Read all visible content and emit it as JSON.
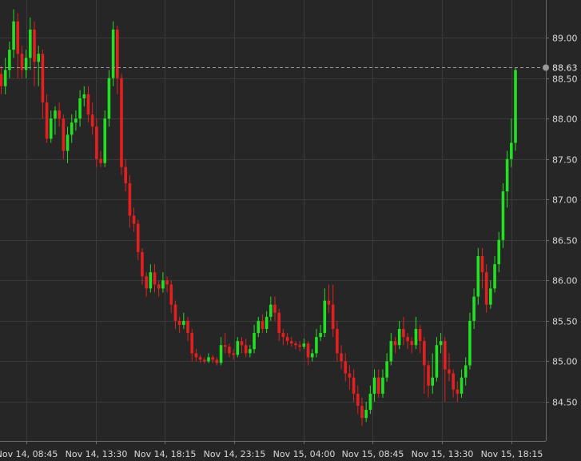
{
  "chart_data": {
    "type": "candlestick",
    "title": "",
    "ylim": [
      84.1,
      89.35
    ],
    "y_ticks": [
      "89.00",
      "88.50",
      "88.00",
      "87.50",
      "87.00",
      "86.50",
      "86.00",
      "85.50",
      "85.00",
      "84.50"
    ],
    "x_ticks": [
      "Nov 14, 08:45",
      "Nov 14, 13:30",
      "Nov 14, 18:15",
      "Nov 14, 23:15",
      "Nov 15, 04:00",
      "Nov 15, 08:45",
      "Nov 15, 13:30",
      "Nov 15, 18:15"
    ],
    "last_price": "88.63",
    "grid": true,
    "colors": {
      "up": "#22e022",
      "down": "#e41f1f",
      "background": "#262626",
      "grid": "#3a3a3a",
      "text": "#d9d9d9",
      "last_line": "#9a9a9a"
    },
    "candles": [
      [
        88.55,
        88.4,
        88.65,
        88.3
      ],
      [
        88.4,
        88.6,
        88.75,
        88.3
      ],
      [
        88.6,
        88.85,
        88.95,
        88.5
      ],
      [
        88.85,
        89.2,
        89.35,
        88.75
      ],
      [
        89.2,
        88.8,
        89.3,
        88.5
      ],
      [
        88.8,
        88.6,
        88.9,
        88.5
      ],
      [
        88.6,
        88.75,
        88.85,
        88.5
      ],
      [
        88.75,
        89.1,
        89.25,
        88.6
      ],
      [
        89.1,
        88.7,
        89.2,
        88.4
      ],
      [
        88.7,
        88.8,
        88.9,
        88.4
      ],
      [
        88.8,
        88.2,
        88.85,
        88.0
      ],
      [
        88.2,
        87.75,
        88.3,
        87.7
      ],
      [
        87.75,
        88.0,
        88.1,
        87.7
      ],
      [
        88.0,
        88.1,
        88.15,
        87.8
      ],
      [
        88.1,
        88.0,
        88.2,
        87.9
      ],
      [
        88.0,
        87.6,
        88.05,
        87.5
      ],
      [
        87.6,
        87.8,
        87.9,
        87.45
      ],
      [
        87.8,
        87.95,
        88.05,
        87.7
      ],
      [
        87.95,
        88.0,
        88.1,
        87.85
      ],
      [
        88.0,
        88.25,
        88.35,
        87.9
      ],
      [
        88.25,
        88.3,
        88.4,
        88.15
      ],
      [
        88.3,
        88.05,
        88.4,
        87.95
      ],
      [
        88.05,
        87.9,
        88.2,
        87.8
      ],
      [
        87.9,
        87.5,
        88.0,
        87.4
      ],
      [
        87.5,
        87.45,
        87.6,
        87.4
      ],
      [
        87.45,
        88.0,
        88.1,
        87.4
      ],
      [
        88.0,
        88.5,
        88.6,
        87.9
      ],
      [
        88.5,
        89.1,
        89.2,
        88.4
      ],
      [
        89.1,
        88.5,
        89.15,
        88.3
      ],
      [
        88.5,
        87.4,
        88.55,
        87.3
      ],
      [
        87.4,
        87.2,
        87.5,
        87.1
      ],
      [
        87.2,
        86.8,
        87.3,
        86.65
      ],
      [
        86.8,
        86.7,
        86.9,
        86.6
      ],
      [
        86.7,
        86.35,
        86.75,
        86.25
      ],
      [
        86.35,
        86.05,
        86.4,
        85.95
      ],
      [
        86.05,
        85.9,
        86.1,
        85.8
      ],
      [
        85.9,
        86.1,
        86.2,
        85.85
      ],
      [
        86.1,
        85.95,
        86.2,
        85.85
      ],
      [
        85.95,
        85.9,
        86.0,
        85.8
      ],
      [
        85.9,
        86.0,
        86.1,
        85.85
      ],
      [
        86.0,
        85.95,
        86.05,
        85.85
      ],
      [
        85.95,
        85.7,
        86.0,
        85.6
      ],
      [
        85.7,
        85.5,
        85.75,
        85.4
      ],
      [
        85.5,
        85.45,
        85.55,
        85.35
      ],
      [
        85.45,
        85.5,
        85.6,
        85.4
      ],
      [
        85.5,
        85.35,
        85.55,
        85.25
      ],
      [
        85.35,
        85.1,
        85.4,
        85.0
      ],
      [
        85.1,
        85.05,
        85.15,
        85.0
      ],
      [
        85.05,
        85.02,
        85.08,
        84.98
      ],
      [
        85.02,
        85.0,
        85.05,
        84.97
      ],
      [
        85.0,
        85.05,
        85.1,
        84.98
      ],
      [
        85.05,
        85.02,
        85.08,
        84.98
      ],
      [
        85.02,
        84.98,
        85.05,
        84.95
      ],
      [
        84.98,
        85.2,
        85.3,
        84.95
      ],
      [
        85.2,
        85.18,
        85.35,
        85.1
      ],
      [
        85.18,
        85.1,
        85.22,
        85.05
      ],
      [
        85.1,
        85.08,
        85.15,
        85.02
      ],
      [
        85.08,
        85.25,
        85.3,
        85.05
      ],
      [
        85.25,
        85.2,
        85.3,
        85.1
      ],
      [
        85.2,
        85.1,
        85.28,
        85.05
      ],
      [
        85.1,
        85.15,
        85.2,
        85.05
      ],
      [
        85.15,
        85.35,
        85.45,
        85.1
      ],
      [
        85.35,
        85.5,
        85.55,
        85.3
      ],
      [
        85.5,
        85.4,
        85.58,
        85.35
      ],
      [
        85.4,
        85.55,
        85.62,
        85.35
      ],
      [
        85.55,
        85.7,
        85.8,
        85.5
      ],
      [
        85.7,
        85.6,
        85.8,
        85.5
      ],
      [
        85.6,
        85.35,
        85.65,
        85.25
      ],
      [
        85.35,
        85.3,
        85.4,
        85.2
      ],
      [
        85.3,
        85.25,
        85.35,
        85.2
      ],
      [
        85.25,
        85.22,
        85.3,
        85.18
      ],
      [
        85.22,
        85.2,
        85.25,
        85.15
      ],
      [
        85.2,
        85.18,
        85.25,
        85.12
      ],
      [
        85.18,
        85.22,
        85.28,
        85.15
      ],
      [
        85.22,
        85.05,
        85.25,
        84.95
      ],
      [
        85.05,
        85.1,
        85.15,
        85.0
      ],
      [
        85.1,
        85.3,
        85.4,
        85.05
      ],
      [
        85.3,
        85.35,
        85.45,
        85.25
      ],
      [
        85.35,
        85.75,
        85.9,
        85.3
      ],
      [
        85.75,
        85.7,
        85.95,
        85.6
      ],
      [
        85.7,
        85.4,
        85.95,
        85.3
      ],
      [
        85.4,
        85.1,
        85.5,
        85.0
      ],
      [
        85.1,
        85.0,
        85.2,
        84.9
      ],
      [
        85.0,
        84.85,
        85.1,
        84.75
      ],
      [
        84.85,
        84.8,
        84.95,
        84.65
      ],
      [
        84.8,
        84.6,
        84.9,
        84.5
      ],
      [
        84.6,
        84.45,
        84.7,
        84.35
      ],
      [
        84.45,
        84.3,
        84.55,
        84.2
      ],
      [
        84.3,
        84.4,
        84.5,
        84.25
      ],
      [
        84.4,
        84.6,
        84.7,
        84.35
      ],
      [
        84.6,
        84.8,
        84.9,
        84.5
      ],
      [
        84.8,
        84.6,
        84.9,
        84.55
      ],
      [
        84.6,
        84.8,
        84.9,
        84.55
      ],
      [
        84.8,
        85.0,
        85.1,
        84.75
      ],
      [
        85.0,
        85.25,
        85.35,
        84.95
      ],
      [
        85.25,
        85.2,
        85.3,
        85.1
      ],
      [
        85.2,
        85.4,
        85.5,
        85.15
      ],
      [
        85.4,
        85.3,
        85.55,
        85.2
      ],
      [
        85.3,
        85.25,
        85.35,
        85.15
      ],
      [
        85.25,
        85.2,
        85.3,
        85.1
      ],
      [
        85.2,
        85.4,
        85.55,
        85.15
      ],
      [
        85.4,
        85.25,
        85.45,
        85.1
      ],
      [
        85.25,
        84.95,
        85.3,
        84.6
      ],
      [
        84.95,
        84.7,
        85.0,
        84.55
      ],
      [
        84.7,
        84.8,
        85.1,
        84.6
      ],
      [
        84.8,
        85.2,
        85.3,
        84.75
      ],
      [
        85.2,
        85.25,
        85.35,
        85.1
      ],
      [
        85.25,
        84.9,
        85.3,
        84.5
      ],
      [
        84.9,
        84.85,
        85.1,
        84.75
      ],
      [
        84.85,
        84.65,
        84.9,
        84.55
      ],
      [
        84.65,
        84.6,
        84.75,
        84.5
      ],
      [
        84.6,
        84.8,
        84.9,
        84.55
      ],
      [
        84.8,
        84.95,
        85.05,
        84.7
      ],
      [
        84.95,
        85.5,
        85.6,
        84.9
      ],
      [
        85.5,
        85.8,
        85.9,
        85.4
      ],
      [
        85.8,
        86.3,
        86.4,
        85.7
      ],
      [
        86.3,
        86.1,
        86.4,
        85.9
      ],
      [
        86.1,
        85.7,
        86.2,
        85.6
      ],
      [
        85.7,
        85.9,
        86.0,
        85.65
      ],
      [
        85.9,
        86.2,
        86.3,
        85.85
      ],
      [
        86.2,
        86.5,
        86.6,
        86.1
      ],
      [
        86.5,
        87.1,
        87.2,
        86.4
      ],
      [
        87.1,
        87.5,
        87.6,
        86.9
      ],
      [
        87.5,
        87.7,
        88.0,
        87.4
      ],
      [
        87.7,
        88.6,
        88.63,
        87.6
      ]
    ]
  }
}
